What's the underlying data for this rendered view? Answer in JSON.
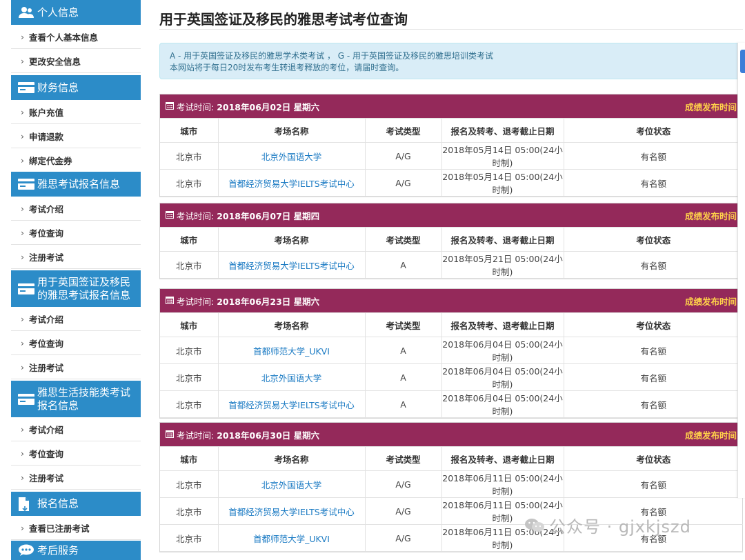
{
  "sidebar": [
    {
      "title": "个人信息",
      "icon": "user-icon",
      "items": [
        "查看个人基本信息",
        "更改安全信息"
      ]
    },
    {
      "title": "财务信息",
      "icon": "card-icon",
      "items": [
        "账户充值",
        "申请退款",
        "绑定代金券"
      ]
    },
    {
      "title": "雅思考试报名信息",
      "icon": "card-icon",
      "items": [
        "考试介绍",
        "考位查询",
        "注册考试"
      ]
    },
    {
      "title": "用于英国签证及移民的雅思考试报名信息",
      "icon": "card-icon",
      "items": [
        "考试介绍",
        "考位查询",
        "注册考试"
      ]
    },
    {
      "title": "雅思生活技能类考试报名信息",
      "icon": "card-icon",
      "items": [
        "考试介绍",
        "考位查询",
        "注册考试"
      ]
    },
    {
      "title": "报名信息",
      "icon": "document-icon",
      "items": [
        "查看已注册考试"
      ]
    },
    {
      "title": "考后服务",
      "icon": "chat-icon",
      "items": []
    }
  ],
  "page": {
    "title": "用于英国签证及移民的雅思考试考位查询",
    "notice_line1": "A - 用于英国签证及移民的雅思学术类考试 ， G - 用于英国签证及移民的雅思培训类考试",
    "notice_line2": "本网站将于每日20时发布考生转退考释放的考位，请届时查询。"
  },
  "exam_header": {
    "prefix": "考试时间:",
    "right": "成绩发布时间"
  },
  "table_columns": [
    "城市",
    "考场名称",
    "考试类型",
    "报名及转考、退考截止日期",
    "考位状态"
  ],
  "exams": [
    {
      "date": "2018年06月02日 星期六",
      "rows": [
        [
          "北京市",
          "北京外国语大学",
          "A/G",
          "2018年05月14日 05:00(24小时制)",
          "有名额"
        ],
        [
          "北京市",
          "首都经济贸易大学IELTS考试中心",
          "A/G",
          "2018年05月14日 05:00(24小时制)",
          "有名额"
        ]
      ]
    },
    {
      "date": "2018年06月07日 星期四",
      "rows": [
        [
          "北京市",
          "首都经济贸易大学IELTS考试中心",
          "A",
          "2018年05月21日 05:00(24小时制)",
          "有名额"
        ]
      ]
    },
    {
      "date": "2018年06月23日 星期六",
      "rows": [
        [
          "北京市",
          "首都师范大学_UKVI",
          "A",
          "2018年06月04日 05:00(24小时制)",
          "有名额"
        ],
        [
          "北京市",
          "北京外国语大学",
          "A",
          "2018年06月04日 05:00(24小时制)",
          "有名额"
        ],
        [
          "北京市",
          "首都经济贸易大学IELTS考试中心",
          "A",
          "2018年06月04日 05:00(24小时制)",
          "有名额"
        ]
      ]
    },
    {
      "date": "2018年06月30日 星期六",
      "rows": [
        [
          "北京市",
          "北京外国语大学",
          "A/G",
          "2018年06月11日 05:00(24小时制)",
          "有名额"
        ],
        [
          "北京市",
          "首都经济贸易大学IELTS考试中心",
          "A/G",
          "2018年06月11日 05:00(24小时制)",
          "有名额"
        ],
        [
          "北京市",
          "首都师范大学_UKVI",
          "A/G",
          "2018年06月11日 05:00(24小时制)",
          "有名额"
        ]
      ]
    }
  ],
  "watermark": {
    "text": "公众号 · gjxkjszd"
  },
  "colors": {
    "sidebar": "#2c8cc8",
    "exam_header": "#94295a",
    "link": "#1a7ac3",
    "result_time": "#ffd24a"
  }
}
